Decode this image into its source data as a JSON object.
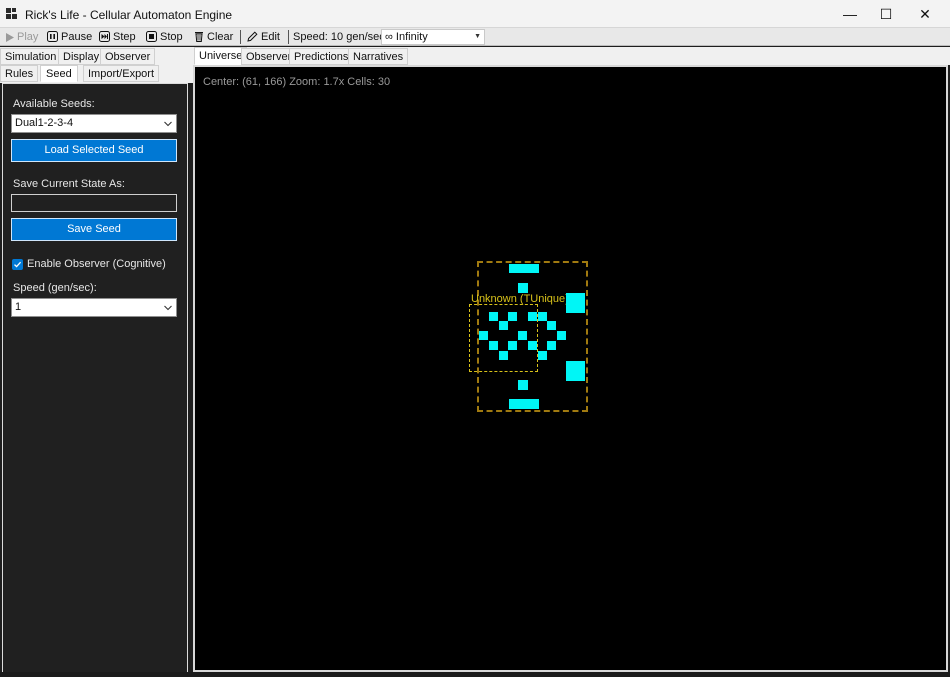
{
  "window": {
    "title": "Rick's Life - Cellular Automaton Engine",
    "controls": [
      "—",
      "☐",
      "✕"
    ]
  },
  "toolbar": {
    "play_label": "Play",
    "pause_label": "Pause",
    "step_label": "Step",
    "stop_label": "Stop",
    "clear_label": "Clear",
    "edit_label": "Edit",
    "speed_label": "Speed: 10 gen/sec",
    "steps_selected": "∞ Infinity"
  },
  "left_tabs": {
    "row1": [
      "Simulation",
      "Display",
      "Observer"
    ],
    "row2": [
      "Rules",
      "Seed",
      "Import/Export"
    ],
    "active": "Seed"
  },
  "seed_panel": {
    "available_seeds_label": "Available Seeds:",
    "selected_seed": "Dual1-2-3-4",
    "load_button": "Load Selected Seed",
    "save_state_label": "Save Current State As:",
    "save_state_value": "",
    "save_button": "Save Seed",
    "observer_checkbox_label": "Enable Observer (Cognitive)",
    "observer_enabled": true,
    "speed_label": "Speed (gen/sec):",
    "speed_value": "1"
  },
  "right_tabs": {
    "tabs": [
      "Universe",
      "Observer",
      "Predictions",
      "Narratives"
    ],
    "active": "Universe"
  },
  "universe": {
    "info": "Center: (61, 166)  Zoom: 1.7x  Cells: 30",
    "observer_label": "Unknown (TUnique)",
    "cell_color": "#00f6f6",
    "outer_box_color": "#a07a10",
    "inner_box_color": "#d8c21a",
    "background": "#000000"
  },
  "colors": {
    "accent": "#0078d4",
    "panel_bg": "#202020"
  }
}
